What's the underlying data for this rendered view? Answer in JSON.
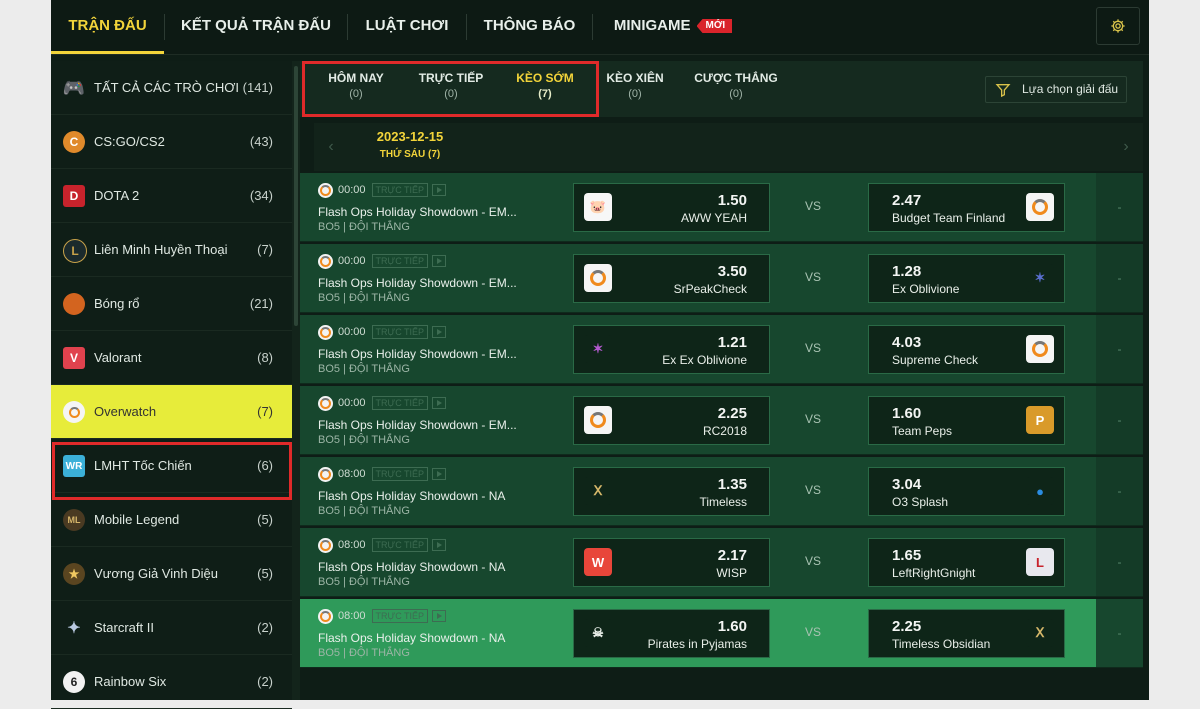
{
  "topnav": {
    "tabs": [
      {
        "label": "TRẬN ĐẤU",
        "active": true
      },
      {
        "label": "KẾT QUẢ TRẬN ĐẤU"
      },
      {
        "label": "LUẬT CHƠI"
      },
      {
        "label": "THÔNG BÁO"
      },
      {
        "label": "MINIGAME",
        "badge": "MỚI"
      }
    ]
  },
  "sidebar": {
    "items": [
      {
        "label": "TẤT CẢ CÁC TRÒ CHƠI",
        "count": "(141)",
        "icon": "gamepad-icon"
      },
      {
        "label": "CS:GO/CS2",
        "count": "(43)",
        "icon": "csgo-icon"
      },
      {
        "label": "DOTA 2",
        "count": "(34)",
        "icon": "dota2-icon"
      },
      {
        "label": "Liên Minh Huyền Thoại",
        "count": "(7)",
        "icon": "lol-icon"
      },
      {
        "label": "Bóng rổ",
        "count": "(21)",
        "icon": "basketball-icon"
      },
      {
        "label": "Valorant",
        "count": "(8)",
        "icon": "valorant-icon"
      },
      {
        "label": "Overwatch",
        "count": "(7)",
        "icon": "overwatch-icon",
        "active": true
      },
      {
        "label": "LMHT Tốc Chiến",
        "count": "(6)",
        "icon": "wildrift-icon"
      },
      {
        "label": "Mobile Legend",
        "count": "(5)",
        "icon": "mobile-legend-icon"
      },
      {
        "label": "Vương Giả Vinh Diệu",
        "count": "(5)",
        "icon": "honor-of-kings-icon"
      },
      {
        "label": "Starcraft II",
        "count": "(2)",
        "icon": "starcraft-icon"
      },
      {
        "label": "Rainbow Six",
        "count": "(2)",
        "icon": "rainbow-six-icon"
      }
    ]
  },
  "subnav": {
    "tabs": [
      {
        "label": "HÔM NAY",
        "count": "(0)"
      },
      {
        "label": "TRỰC TIẾP",
        "count": "(0)"
      },
      {
        "label": "KÈO SỚM",
        "count": "(7)",
        "active": true
      },
      {
        "label": "KÈO XIÊN",
        "count": "(0)"
      },
      {
        "label": "CƯỢC THẮNG",
        "count": "(0)"
      }
    ],
    "filter_label": "Lựa chọn giải đấu"
  },
  "datebar": {
    "date": "2023-12-15",
    "weekday": "THỨ SÁU (7)"
  },
  "live_label": "TRỰC TIẾP",
  "vs_label": "VS",
  "more_label": "-",
  "matches": [
    {
      "time": "00:00",
      "tournament": "Flash Ops Holiday Showdown - EM...",
      "format": "BO5 | ĐỘI THẮNG",
      "home": {
        "odd": "1.50",
        "name": "AWW YEAH",
        "icon": "aww-yeah-logo"
      },
      "away": {
        "odd": "2.47",
        "name": "Budget Team Finland",
        "icon": "overwatch-logo"
      }
    },
    {
      "time": "00:00",
      "tournament": "Flash Ops Holiday Showdown - EM...",
      "format": "BO5 | ĐỘI THẮNG",
      "home": {
        "odd": "3.50",
        "name": "SrPeakCheck",
        "icon": "overwatch-logo"
      },
      "away": {
        "odd": "1.28",
        "name": "Ex Oblivione",
        "icon": "ex-oblivione-logo"
      }
    },
    {
      "time": "00:00",
      "tournament": "Flash Ops Holiday Showdown - EM...",
      "format": "BO5 | ĐỘI THẮNG",
      "home": {
        "odd": "1.21",
        "name": "Ex Ex Oblivione",
        "icon": "ex-ex-oblivione-logo"
      },
      "away": {
        "odd": "4.03",
        "name": "Supreme Check",
        "icon": "overwatch-logo"
      }
    },
    {
      "time": "00:00",
      "tournament": "Flash Ops Holiday Showdown - EM...",
      "format": "BO5 | ĐỘI THẮNG",
      "home": {
        "odd": "2.25",
        "name": "RC2018",
        "icon": "overwatch-logo"
      },
      "away": {
        "odd": "1.60",
        "name": "Team Peps",
        "icon": "team-peps-logo"
      }
    },
    {
      "time": "08:00",
      "tournament": "Flash Ops Holiday Showdown - NA",
      "format": "BO5 | ĐỘI THẮNG",
      "home": {
        "odd": "1.35",
        "name": "Timeless",
        "icon": "timeless-logo"
      },
      "away": {
        "odd": "3.04",
        "name": "O3 Splash",
        "icon": "o3-splash-logo"
      }
    },
    {
      "time": "08:00",
      "tournament": "Flash Ops Holiday Showdown - NA",
      "format": "BO5 | ĐỘI THẮNG",
      "home": {
        "odd": "2.17",
        "name": "WISP",
        "icon": "wisp-logo"
      },
      "away": {
        "odd": "1.65",
        "name": "LeftRightGnight",
        "icon": "leftrightgnight-logo"
      }
    },
    {
      "time": "08:00",
      "tournament": "Flash Ops Holiday Showdown - NA",
      "format": "BO5 | ĐỘI THẮNG",
      "home": {
        "odd": "1.60",
        "name": "Pirates in Pyjamas",
        "icon": "pirates-in-pyjamas-logo"
      },
      "away": {
        "odd": "2.25",
        "name": "Timeless Obsidian",
        "icon": "timeless-obsidian-logo"
      },
      "highlighted": true
    }
  ],
  "colors": {
    "accent": "#f2d43a",
    "active_sidebar": "#e7ec3a",
    "highlight_border": "#e02a2a",
    "badge": "#d9242b",
    "row": "#17472e",
    "row_highlight": "#2f9a5a"
  }
}
